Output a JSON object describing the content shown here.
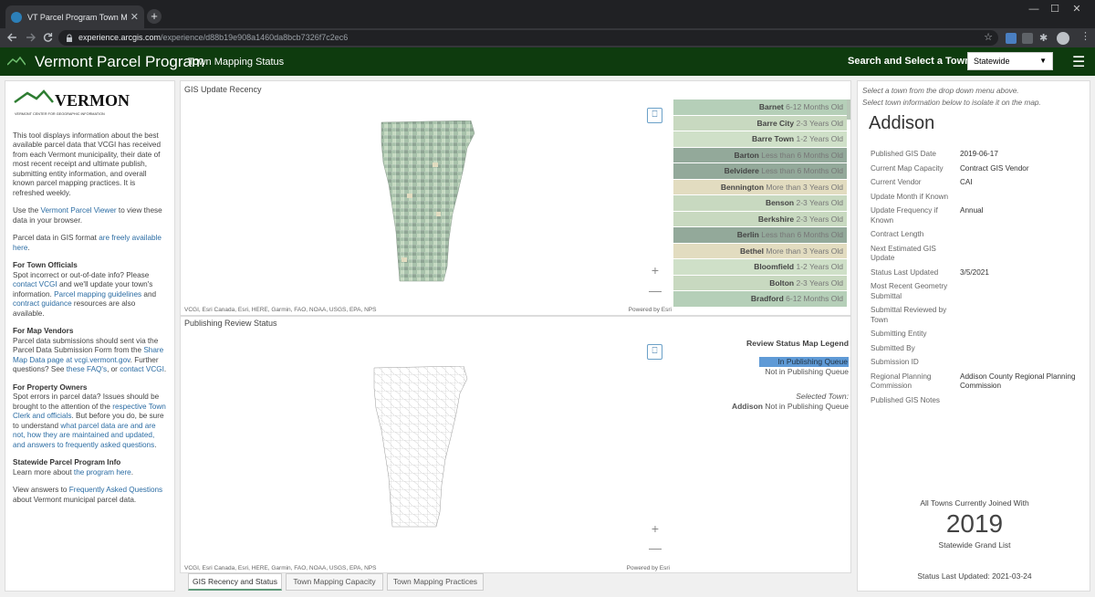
{
  "browser": {
    "tab_title": "VT Parcel Program Town Mapping",
    "tab_close": "✕",
    "new_tab": "+",
    "window_controls": [
      "—",
      "☐",
      "✕"
    ],
    "url_domain": "experience.arcgis.com",
    "url_path": "/experience/d88b19e908a1460da8bcb7326f7c2ec6",
    "nav_icons": [
      "arrow-left-icon",
      "arrow-right-icon",
      "reload-icon"
    ],
    "ext_badge": "0"
  },
  "app": {
    "title": "Vermont Parcel Program",
    "subtitle": "Town Mapping Status",
    "search_label": "Search and Select a Town:",
    "select_value": "Statewide",
    "header_color": "#0e3b0e"
  },
  "left": {
    "logo_text": "VERMONT",
    "logo_subtext": "VERMONT CENTER FOR GEOGRAPHIC INFORMATION",
    "intro": "This tool displays information about the best available parcel data that VCGI has received from each Vermont municipality, their date of most recent receipt and ultimate publish, submitting entity information, and overall known parcel mapping practices. It is refreshed weekly.",
    "use_pre": "Use the ",
    "use_link": "Vermont Parcel Viewer",
    "use_post": " to view these data in your browser.",
    "gis_pre": "Parcel data in GIS format ",
    "gis_link": "are freely available here",
    "gis_post": ".",
    "officials_hd": "For Town Officials",
    "officials_1": "Spot incorrect or out-of-date info? Please ",
    "officials_link1": "contact VCGI",
    "officials_2": " and we'll update your town's information. ",
    "officials_link2": "Parcel mapping guidelines",
    "officials_3": " and ",
    "officials_link3": "contract guidance",
    "officials_4": " resources are also available.",
    "vendors_hd": "For Map Vendors",
    "vendors_1": "Parcel data submissions should sent via the Parcel Data Submission Form from the ",
    "vendors_link1": "Share Map Data page at vcgi.vermont.gov",
    "vendors_2": ". Further questions? See ",
    "vendors_link2": "these FAQ's",
    "vendors_3": ", or ",
    "vendors_link3": "contact VCGI",
    "vendors_4": ".",
    "owners_hd": "For Property Owners",
    "owners_1": "Spot errors in parcel data? Issues should be brought to the attention of the ",
    "owners_link1": "respective Town Clerk and officials",
    "owners_2": ". But before you do, be sure to understand ",
    "owners_link2": "what parcel data are and are not, how they are maintained and updated, and answers to frequently asked questions",
    "owners_3": ".",
    "statewide_hd": "Statewide Parcel Program Info",
    "statewide_1": "Learn more about ",
    "statewide_link": "the program here",
    "statewide_2": ".",
    "faq_1": "View answers to ",
    "faq_link": "Frequently Asked Questions",
    "faq_2": " about Vermont municipal parcel data."
  },
  "map1": {
    "title": "GIS Update Recency",
    "attribution": "VCGI, Esri Canada, Esri, HERE, Garmin, FAO, NOAA, USGS, EPA, NPS",
    "powered": "Powered by Esri",
    "zoom_in": "+",
    "zoom_out": "—",
    "bookmark_icon": "bookmark-icon",
    "towns": [
      {
        "name": "Barnet",
        "status": "6-12 Months Old",
        "color": "#b5cfb8"
      },
      {
        "name": "Barre City",
        "status": "2-3 Years Old",
        "color": "#c8d9c0"
      },
      {
        "name": "Barre Town",
        "status": "1-2 Years Old",
        "color": "#cfe0c8"
      },
      {
        "name": "Barton",
        "status": "Less than 6 Months Old",
        "color": "#93a99a"
      },
      {
        "name": "Belvidere",
        "status": "Less than 6 Months Old",
        "color": "#93a99a"
      },
      {
        "name": "Bennington",
        "status": "More than 3 Years Old",
        "color": "#e2dcc0"
      },
      {
        "name": "Benson",
        "status": "2-3 Years Old",
        "color": "#c8d9c0"
      },
      {
        "name": "Berkshire",
        "status": "2-3 Years Old",
        "color": "#c8d9c0"
      },
      {
        "name": "Berlin",
        "status": "Less than 6 Months Old",
        "color": "#93a99a"
      },
      {
        "name": "Bethel",
        "status": "More than 3 Years Old",
        "color": "#e2dcc0"
      },
      {
        "name": "Bloomfield",
        "status": "1-2 Years Old",
        "color": "#cfe0c8"
      },
      {
        "name": "Bolton",
        "status": "2-3 Years Old",
        "color": "#c8d9c0"
      },
      {
        "name": "Bradford",
        "status": "6-12 Months Old",
        "color": "#b5cfb8"
      }
    ]
  },
  "map2": {
    "title": "Publishing Review Status",
    "attribution": "VCGI, Esri Canada, Esri, HERE, Garmin, FAO, NOAA, USGS, EPA, NPS",
    "powered": "Powered by Esri",
    "zoom_in": "+",
    "zoom_out": "—",
    "legend_title": "Review Status Map Legend",
    "legend_in": "In Publishing Queue",
    "legend_not": "Not in Publishing Queue",
    "legend_in_color": "#5f9ad6",
    "selected_label": "Selected Town:",
    "selected_town": "Addison",
    "selected_status": "Not in Publishing Queue"
  },
  "tabs": [
    "GIS Recency and Status",
    "Town Mapping Capacity",
    "Town Mapping Practices"
  ],
  "right": {
    "hint_1": "Select a town from the drop down menu above.",
    "hint_2": "Select town information below to isolate it on the map.",
    "town": "Addison",
    "details": [
      {
        "k": "Published GIS Date",
        "v": "2019-06-17"
      },
      {
        "k": "Current Map Capacity",
        "v": "Contract GIS Vendor"
      },
      {
        "k": "Current Vendor",
        "v": "CAI"
      },
      {
        "k": "Update Month if Known",
        "v": ""
      },
      {
        "k": "Update Frequency if Known",
        "v": "Annual"
      },
      {
        "k": "Contract Length",
        "v": ""
      },
      {
        "k": "Next Estimated GIS Update",
        "v": ""
      },
      {
        "k": "Status Last Updated",
        "v": "3/5/2021"
      },
      {
        "k": "Most Recent Geometry Submittal",
        "v": ""
      },
      {
        "k": "Submittal Reviewed by Town",
        "v": ""
      },
      {
        "k": "Submitting Entity",
        "v": ""
      },
      {
        "k": "Submitted By",
        "v": ""
      },
      {
        "k": "Submission ID",
        "v": ""
      },
      {
        "k": "Regional Planning Commission",
        "v": "Addison County Regional Planning Commission"
      },
      {
        "k": "Published GIS Notes",
        "v": ""
      }
    ],
    "foot_label": "All Towns Currently Joined With",
    "foot_year": "2019",
    "foot_sub": "Statewide Grand List",
    "foot_status": "Status Last Updated: 2021-03-24"
  }
}
